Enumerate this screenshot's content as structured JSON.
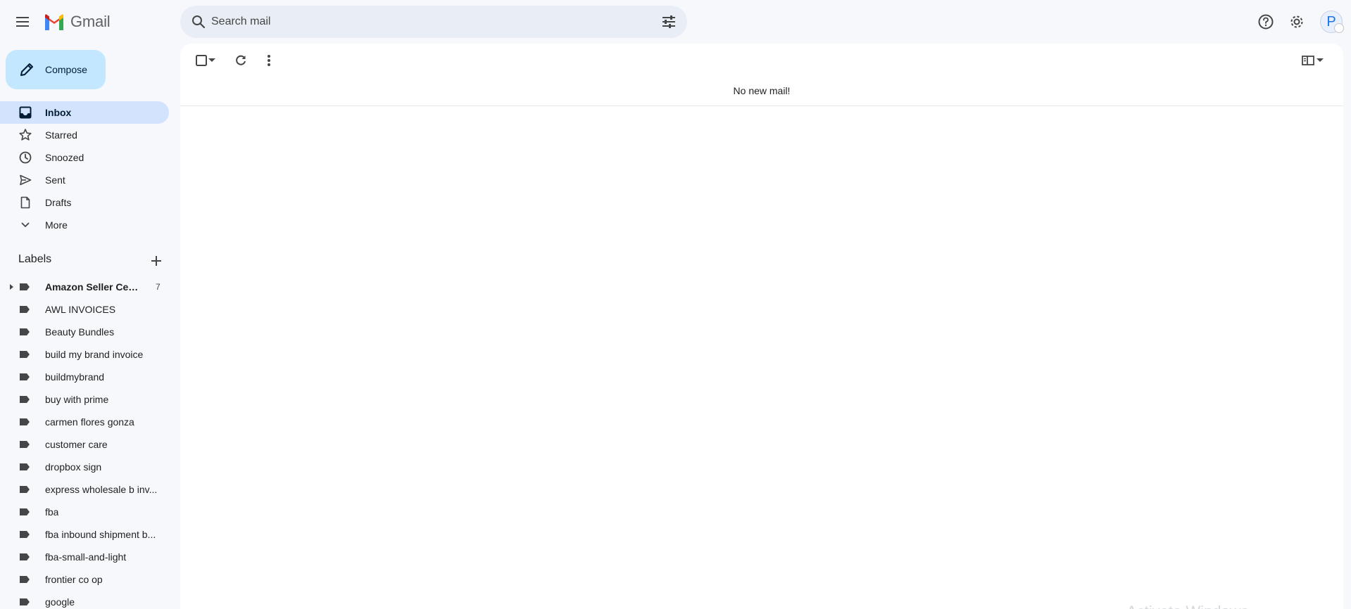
{
  "app": {
    "name": "Gmail"
  },
  "search": {
    "placeholder": "Search mail"
  },
  "compose": {
    "label": "Compose"
  },
  "nav": [
    {
      "label": "Inbox",
      "icon": "inbox-icon",
      "active": true
    },
    {
      "label": "Starred",
      "icon": "star-icon"
    },
    {
      "label": "Snoozed",
      "icon": "clock-icon"
    },
    {
      "label": "Sent",
      "icon": "send-icon"
    },
    {
      "label": "Drafts",
      "icon": "draft-icon"
    },
    {
      "label": "More",
      "icon": "chevron-down-icon"
    }
  ],
  "labels": {
    "title": "Labels",
    "items": [
      {
        "name": "Amazon Seller Cen...",
        "count": "7",
        "bold": true,
        "expandable": true
      },
      {
        "name": "AWL INVOICES"
      },
      {
        "name": "Beauty Bundles"
      },
      {
        "name": "build my brand invoice"
      },
      {
        "name": "buildmybrand"
      },
      {
        "name": "buy with prime"
      },
      {
        "name": "carmen flores gonza"
      },
      {
        "name": "customer care"
      },
      {
        "name": "dropbox sign"
      },
      {
        "name": "express wholesale b inv..."
      },
      {
        "name": "fba"
      },
      {
        "name": "fba inbound shipment b..."
      },
      {
        "name": "fba-small-and-light"
      },
      {
        "name": "frontier co op"
      },
      {
        "name": "google"
      }
    ]
  },
  "main": {
    "empty_message": "No new mail!"
  },
  "account": {
    "avatar_letter": "P"
  },
  "colors": {
    "accent": "#c2e7ff",
    "active_nav": "#d3e3fd",
    "background": "#f6f8fc"
  },
  "watermark": "Activate Windows"
}
